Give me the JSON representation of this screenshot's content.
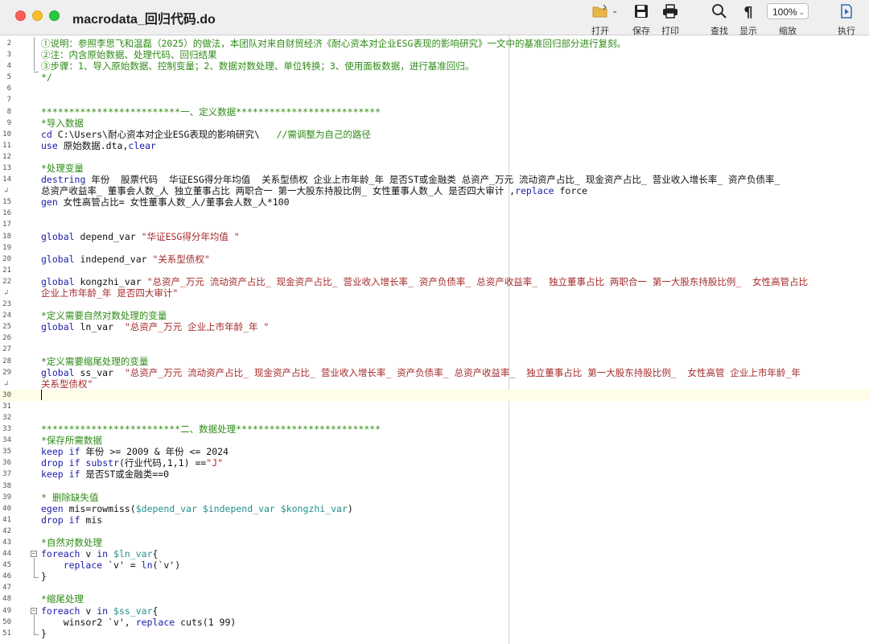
{
  "window": {
    "title": "macrodata_回归代码.do"
  },
  "toolbar": {
    "open": "打开",
    "save": "保存",
    "print": "打印",
    "find": "查找",
    "show": "显示",
    "zoom_label": "缩放",
    "zoom_value": "100%",
    "run": "执行",
    "icons": {
      "open": "folder-icon",
      "save": "floppy-disk-icon",
      "print": "printer-icon",
      "find": "magnifier-icon",
      "show": "pilcrow-icon",
      "run": "run-document-icon"
    }
  },
  "colors": {
    "comment": "#2e8b16",
    "keyword": "#1b1ba8",
    "string": "#a52a2a",
    "macro": "#238f8f",
    "current_line": "#fffce8"
  },
  "editor": {
    "lines": [
      {
        "n": "2",
        "spans": [
          [
            "cm",
            "①说明：参照李思飞和温磊（2025）的做法，本团队对来自财贸经济《耐心资本对企业ESG表现的影响研究》一文中的基准回归部分进行复刻。"
          ]
        ]
      },
      {
        "n": "3",
        "spans": [
          [
            "cm",
            "②注：内含原始数据、处理代码、回归结果"
          ]
        ]
      },
      {
        "n": "4",
        "spans": [
          [
            "cm",
            "③步骤：1、导入原始数据、控制变量；2、数据对数处理、单位转换；3、使用面板数据，进行基准回归。"
          ]
        ]
      },
      {
        "n": "5",
        "spans": [
          [
            "cm",
            "*/"
          ]
        ]
      },
      {
        "n": "6",
        "spans": []
      },
      {
        "n": "7",
        "spans": []
      },
      {
        "n": "8",
        "spans": [
          [
            "cm",
            "*************************一、定义数据**************************"
          ]
        ]
      },
      {
        "n": "9",
        "spans": [
          [
            "cm",
            "*导入数据"
          ]
        ]
      },
      {
        "n": "10",
        "spans": [
          [
            "kw",
            "cd"
          ],
          [
            "",
            " C:\\Users\\耐心资本对企业ESG表现的影响研究\\   "
          ],
          [
            "cm",
            "//需调整为自己的路径"
          ]
        ]
      },
      {
        "n": "11",
        "spans": [
          [
            "kw",
            "use"
          ],
          [
            "",
            " 原始数据.dta,"
          ],
          [
            "kw",
            "clear"
          ]
        ]
      },
      {
        "n": "12",
        "spans": []
      },
      {
        "n": "13",
        "spans": [
          [
            "cm",
            "*处理变量"
          ]
        ]
      },
      {
        "n": "14",
        "spans": [
          [
            "kw",
            "destring"
          ],
          [
            "",
            " 年份  股票代码  华证ESG得分年均值  关系型债权 企业上市年龄_年 是否ST或金融类 总资产_万元 流动资产占比_ 现金资产占比_ 营业收入增长率_ 资产负债率_"
          ]
        ]
      },
      {
        "n": "",
        "wrap": true,
        "spans": [
          [
            "",
            "总资产收益率_ 董事会人数_人 独立董事占比 两职合一 第一大股东持股比例_ 女性董事人数_人 是否四大审计 ,"
          ],
          [
            "kw",
            "replace"
          ],
          [
            "",
            " force"
          ]
        ]
      },
      {
        "n": "15",
        "spans": [
          [
            "kw",
            "gen"
          ],
          [
            "",
            " 女性高管占比= 女性董事人数_人/董事会人数_人*100"
          ]
        ]
      },
      {
        "n": "16",
        "spans": []
      },
      {
        "n": "17",
        "spans": []
      },
      {
        "n": "18",
        "spans": [
          [
            "kw",
            "global"
          ],
          [
            "",
            " depend_var "
          ],
          [
            "str",
            "\"华证ESG得分年均值 \""
          ]
        ]
      },
      {
        "n": "19",
        "spans": []
      },
      {
        "n": "20",
        "spans": [
          [
            "kw",
            "global"
          ],
          [
            "",
            " independ_var "
          ],
          [
            "str",
            "\"关系型债权\""
          ]
        ]
      },
      {
        "n": "21",
        "spans": []
      },
      {
        "n": "22",
        "spans": [
          [
            "kw",
            "global"
          ],
          [
            "",
            " kongzhi_var "
          ],
          [
            "str",
            "\"总资产_万元 流动资产占比_ 现金资产占比_ 营业收入增长率_ 资产负债率_ 总资产收益率_  独立董事占比 两职合一 第一大股东持股比例_  女性高管占比"
          ]
        ]
      },
      {
        "n": "",
        "wrap": true,
        "spans": [
          [
            "str",
            "企业上市年龄_年 是否四大审计\""
          ]
        ]
      },
      {
        "n": "23",
        "spans": []
      },
      {
        "n": "24",
        "spans": [
          [
            "cm",
            "*定义需要自然对数处理的变量"
          ]
        ]
      },
      {
        "n": "25",
        "spans": [
          [
            "kw",
            "global"
          ],
          [
            "",
            " ln_var  "
          ],
          [
            "str",
            "\"总资产_万元 企业上市年龄_年 \""
          ]
        ]
      },
      {
        "n": "26",
        "spans": []
      },
      {
        "n": "27",
        "spans": []
      },
      {
        "n": "28",
        "spans": [
          [
            "cm",
            "*定义需要缩尾处理的变量"
          ]
        ]
      },
      {
        "n": "29",
        "spans": [
          [
            "kw",
            "global"
          ],
          [
            "",
            " ss_var  "
          ],
          [
            "str",
            "\"总资产_万元 流动资产占比_ 现金资产占比_ 营业收入增长率_ 资产负债率_ 总资产收益率_  独立董事占比 第一大股东持股比例_  女性高管 企业上市年龄_年"
          ]
        ]
      },
      {
        "n": "",
        "wrap": true,
        "spans": [
          [
            "str",
            "关系型债权\""
          ]
        ]
      },
      {
        "n": "30",
        "current": true,
        "spans": []
      },
      {
        "n": "31",
        "spans": []
      },
      {
        "n": "32",
        "spans": []
      },
      {
        "n": "33",
        "spans": [
          [
            "cm",
            "*************************二、数据处理**************************"
          ]
        ]
      },
      {
        "n": "34",
        "spans": [
          [
            "cm",
            "*保存所需数据"
          ]
        ]
      },
      {
        "n": "35",
        "spans": [
          [
            "kw",
            "keep"
          ],
          [
            "",
            " "
          ],
          [
            "kw",
            "if"
          ],
          [
            "",
            " 年份 >= 2009 & 年份 <= 2024"
          ]
        ]
      },
      {
        "n": "36",
        "spans": [
          [
            "kw",
            "drop"
          ],
          [
            "",
            " "
          ],
          [
            "kw",
            "if"
          ],
          [
            "",
            " "
          ],
          [
            "kw",
            "substr"
          ],
          [
            "",
            "(行业代码,1,1) =="
          ],
          [
            "str",
            "\"J\""
          ]
        ]
      },
      {
        "n": "37",
        "spans": [
          [
            "kw",
            "keep"
          ],
          [
            "",
            " "
          ],
          [
            "kw",
            "if"
          ],
          [
            "",
            " 是否ST或金融类==0"
          ]
        ]
      },
      {
        "n": "38",
        "spans": []
      },
      {
        "n": "39",
        "spans": [
          [
            "cm",
            "* 删除缺失值"
          ]
        ]
      },
      {
        "n": "40",
        "spans": [
          [
            "kw",
            "egen"
          ],
          [
            "",
            " mis=rowmiss("
          ],
          [
            "mac",
            "$depend_var"
          ],
          [
            "",
            " "
          ],
          [
            "mac",
            "$independ_var"
          ],
          [
            "",
            " "
          ],
          [
            "mac",
            "$kongzhi_var"
          ],
          [
            "",
            ")"
          ]
        ]
      },
      {
        "n": "41",
        "spans": [
          [
            "kw",
            "drop"
          ],
          [
            "",
            " "
          ],
          [
            "kw",
            "if"
          ],
          [
            "",
            " mis"
          ]
        ]
      },
      {
        "n": "42",
        "spans": []
      },
      {
        "n": "43",
        "spans": [
          [
            "cm",
            "*自然对数处理"
          ]
        ]
      },
      {
        "n": "44",
        "fold": true,
        "spans": [
          [
            "kw",
            "foreach"
          ],
          [
            "",
            " v "
          ],
          [
            "kw",
            "in"
          ],
          [
            "",
            " "
          ],
          [
            "mac",
            "$ln_var"
          ],
          [
            "",
            "{"
          ]
        ]
      },
      {
        "n": "45",
        "spans": [
          [
            "",
            "    "
          ],
          [
            "kw",
            "replace"
          ],
          [
            "",
            " `v' = "
          ],
          [
            "kw",
            "ln"
          ],
          [
            "",
            "(`v')"
          ]
        ]
      },
      {
        "n": "46",
        "spans": [
          [
            "",
            "}"
          ]
        ]
      },
      {
        "n": "47",
        "spans": []
      },
      {
        "n": "48",
        "spans": [
          [
            "cm",
            "*缩尾处理"
          ]
        ]
      },
      {
        "n": "49",
        "fold": true,
        "spans": [
          [
            "kw",
            "foreach"
          ],
          [
            "",
            " v "
          ],
          [
            "kw",
            "in"
          ],
          [
            "",
            " "
          ],
          [
            "mac",
            "$ss_var"
          ],
          [
            "",
            "{"
          ]
        ]
      },
      {
        "n": "50",
        "spans": [
          [
            "",
            "    winsor2 `v', "
          ],
          [
            "kw",
            "replace"
          ],
          [
            "",
            " cuts(1 99)"
          ]
        ]
      },
      {
        "n": "51",
        "spans": [
          [
            "",
            "}"
          ]
        ]
      }
    ]
  }
}
